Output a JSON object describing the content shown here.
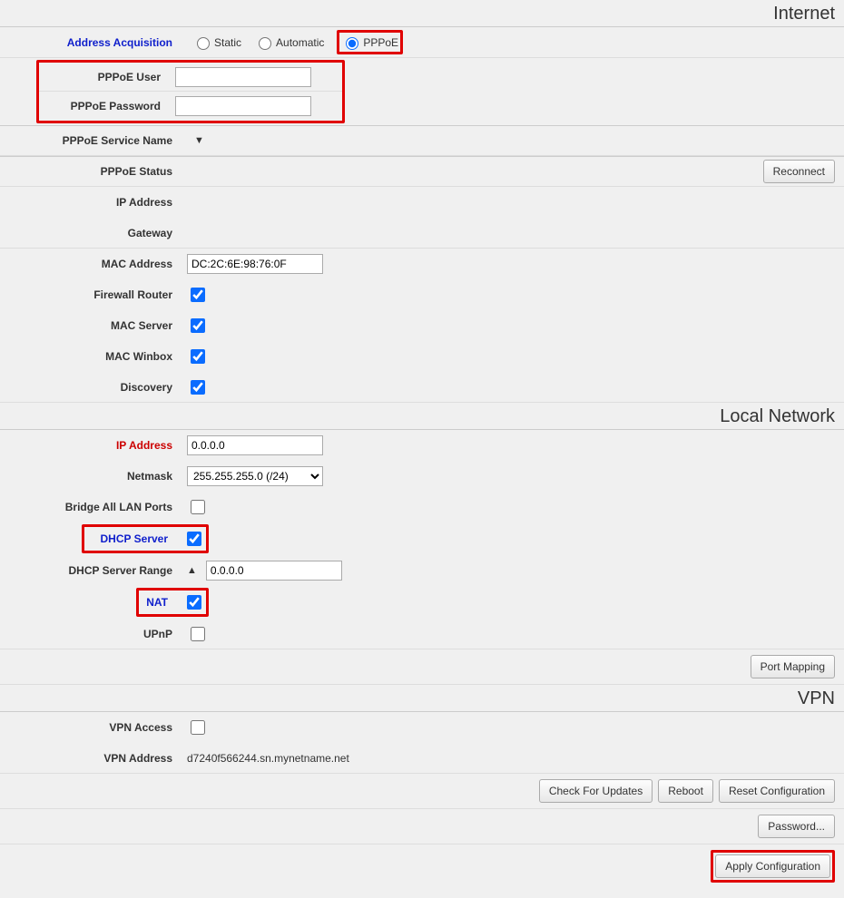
{
  "internet": {
    "title": "Internet",
    "addr_acq_label": "Address Acquisition",
    "radio_static": "Static",
    "radio_auto": "Automatic",
    "radio_pppoe": "PPPoE",
    "pppoe_user_label": "PPPoE User",
    "pppoe_user_value": "",
    "pppoe_pass_label": "PPPoE Password",
    "pppoe_pass_value": "",
    "pppoe_service_label": "PPPoE Service Name",
    "pppoe_status_label": "PPPoE Status",
    "reconnect_btn": "Reconnect",
    "ip_label": "IP Address",
    "gateway_label": "Gateway",
    "mac_label": "MAC Address",
    "mac_value": "DC:2C:6E:98:76:0F",
    "firewall_label": "Firewall Router",
    "macsrv_label": "MAC Server",
    "macwin_label": "MAC Winbox",
    "discovery_label": "Discovery"
  },
  "local": {
    "title": "Local Network",
    "ip_label": "IP Address",
    "ip_value": "0.0.0.0",
    "netmask_label": "Netmask",
    "netmask_value": "255.255.255.0 (/24)",
    "bridge_label": "Bridge All LAN Ports",
    "dhcp_label": "DHCP Server",
    "dhcp_range_label": "DHCP Server Range",
    "dhcp_range_value": "0.0.0.0",
    "nat_label": "NAT",
    "upnp_label": "UPnP",
    "port_mapping_btn": "Port Mapping"
  },
  "vpn": {
    "title": "VPN",
    "access_label": "VPN Access",
    "address_label": "VPN Address",
    "address_value": "d7240f566244.sn.mynetname.net"
  },
  "buttons": {
    "check_updates": "Check For Updates",
    "reboot": "Reboot",
    "reset_config": "Reset Configuration",
    "password": "Password...",
    "apply": "Apply Configuration"
  }
}
